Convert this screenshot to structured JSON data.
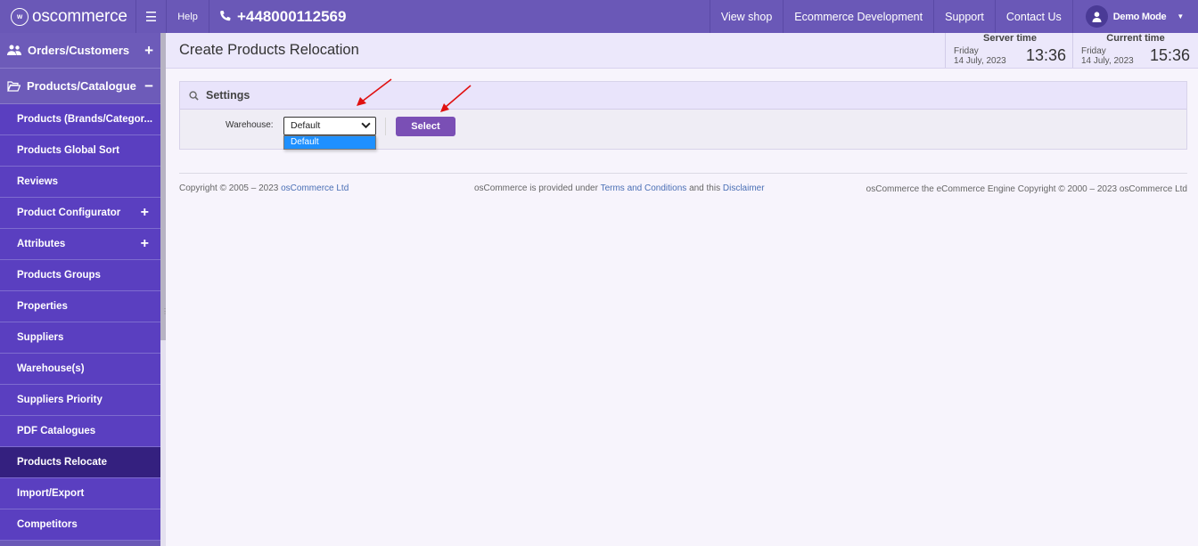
{
  "header": {
    "logo_text": "oscommerce",
    "logo_mark": "w",
    "help_label": "Help",
    "phone": "+448000112569",
    "links": [
      "View shop",
      "Ecommerce Development",
      "Support",
      "Contact Us"
    ],
    "user": "Demo Mode"
  },
  "sidebar": {
    "groups": [
      {
        "label": "Orders/Customers",
        "toggle": "+"
      },
      {
        "label": "Products/Catalogue",
        "toggle": "−"
      }
    ],
    "items": [
      {
        "label": "Products (Brands/Categor...",
        "toggle": ""
      },
      {
        "label": "Products Global Sort",
        "toggle": ""
      },
      {
        "label": "Reviews",
        "toggle": ""
      },
      {
        "label": "Product Configurator",
        "toggle": "+"
      },
      {
        "label": "Attributes",
        "toggle": "+"
      },
      {
        "label": "Products Groups",
        "toggle": ""
      },
      {
        "label": "Properties",
        "toggle": ""
      },
      {
        "label": "Suppliers",
        "toggle": ""
      },
      {
        "label": "Warehouse(s)",
        "toggle": ""
      },
      {
        "label": "Suppliers Priority",
        "toggle": ""
      },
      {
        "label": "PDF Catalogues",
        "toggle": ""
      },
      {
        "label": "Products Relocate",
        "toggle": ""
      },
      {
        "label": "Import/Export",
        "toggle": ""
      },
      {
        "label": "Competitors",
        "toggle": ""
      }
    ],
    "active_item": "Products Relocate"
  },
  "page": {
    "title": "Create Products Relocation",
    "server_time": {
      "label": "Server time",
      "day": "Friday",
      "date": "14 July, 2023",
      "time": "13:36"
    },
    "current_time": {
      "label": "Current time",
      "day": "Friday",
      "date": "14 July, 2023",
      "time": "15:36"
    }
  },
  "settings": {
    "heading": "Settings",
    "warehouse_label": "Warehouse:",
    "warehouse_value": "Default",
    "dropdown_options": [
      "Default"
    ],
    "select_button": "Select"
  },
  "footer": {
    "copyright_prefix": "Copyright © 2005 – 2023",
    "copyright_link": "osCommerce Ltd",
    "provided_prefix": "osCommerce is provided under",
    "terms_link": "Terms and Conditions",
    "and_this": "and this",
    "disclaimer_link": "Disclaimer",
    "engine_text": "osCommerce the eCommerce Engine Copyright © 2000 – 2023 osCommerce Ltd"
  },
  "colors": {
    "topbar": "#6a58b7",
    "sidebar_item": "#5a3fc0",
    "sidebar_active": "#34207f",
    "button": "#7a4fb5",
    "annotation_arrow": "#e01010"
  }
}
